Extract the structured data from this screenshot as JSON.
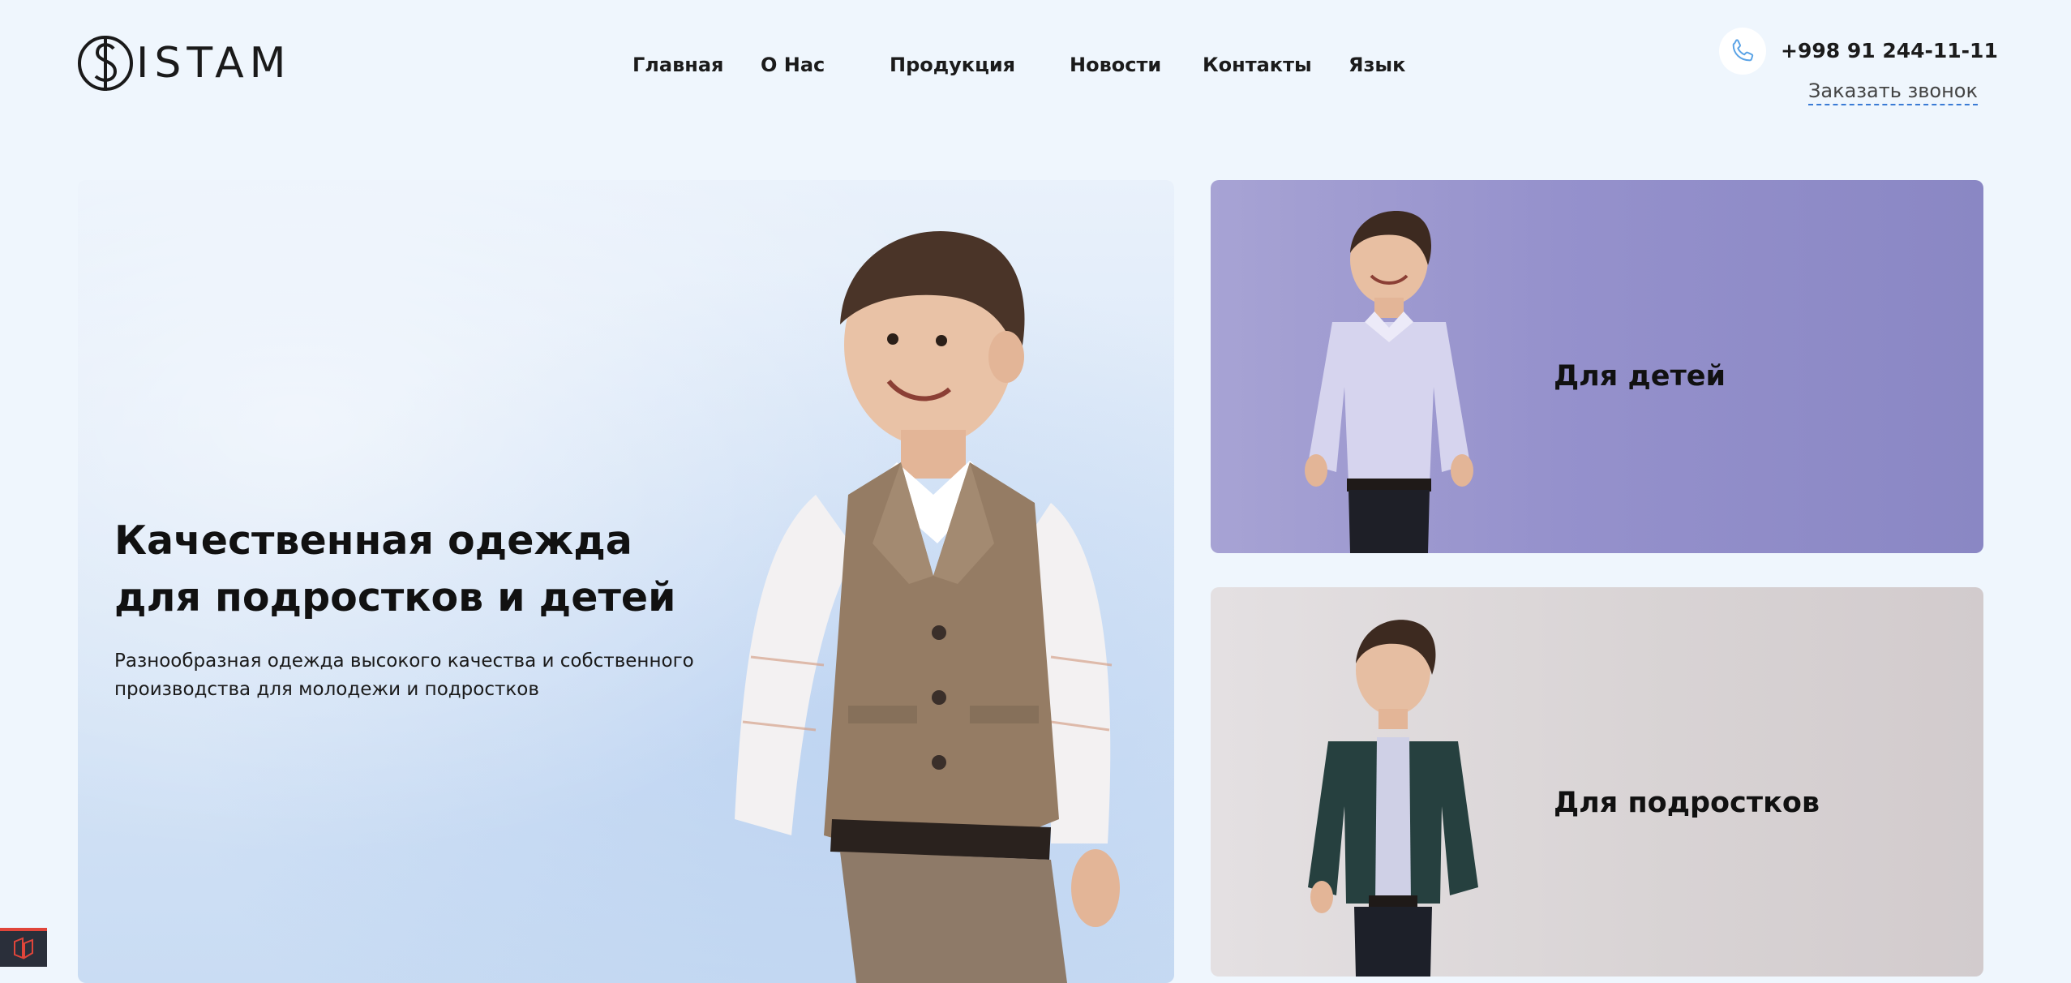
{
  "header": {
    "logo_text": "ISTAM",
    "nav": [
      "Главная",
      "О Нас",
      "Продукция",
      "Новости",
      "Контакты",
      "Язык"
    ],
    "phone": "+998 91 244-11-11",
    "callback_label": "Заказать звонок"
  },
  "hero": {
    "title": "Качественная одежда для подростков и детей",
    "subtitle": "Разнообразная одежда высокого качества и собственного производства для молодежи и подростков"
  },
  "categories": [
    {
      "label": "Для детей"
    },
    {
      "label": "Для подростков"
    }
  ],
  "colors": {
    "page_bg": "#eff6fd",
    "kids_card_bg": "#9591cc",
    "teens_card_bg": "#d9d4d5",
    "callback_underline": "#3a7bd5"
  },
  "icons": [
    "logo-mark-icon",
    "phone-icon",
    "corner-app-icon"
  ]
}
